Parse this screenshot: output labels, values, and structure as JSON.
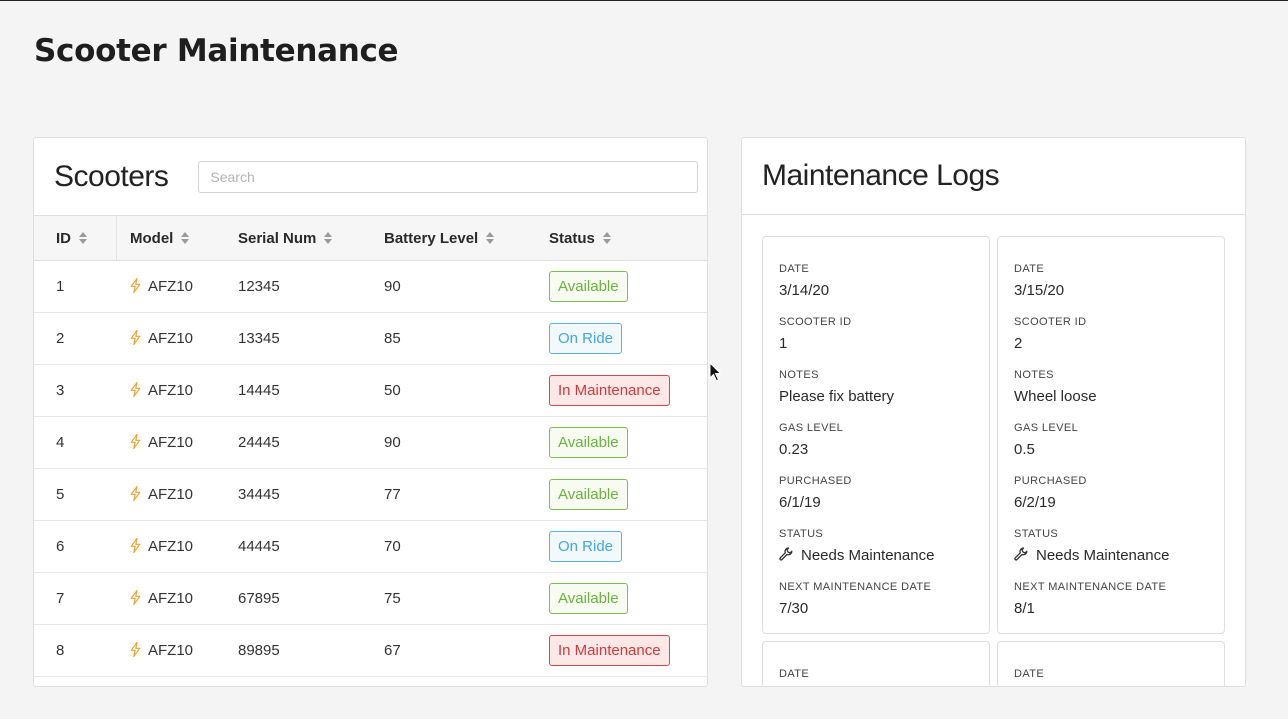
{
  "page": {
    "title": "Scooter Maintenance"
  },
  "scooters": {
    "heading": "Scooters",
    "search_placeholder": "Search",
    "columns": [
      "ID",
      "Model",
      "Serial Num",
      "Battery Level",
      "Status"
    ],
    "rows": [
      {
        "id": "1",
        "model": "AFZ10",
        "serial": "12345",
        "battery": "90",
        "status": "Available",
        "status_type": "available"
      },
      {
        "id": "2",
        "model": "AFZ10",
        "serial": "13345",
        "battery": "85",
        "status": "On Ride",
        "status_type": "onride"
      },
      {
        "id": "3",
        "model": "AFZ10",
        "serial": "14445",
        "battery": "50",
        "status": "In Maintenance",
        "status_type": "maintenance"
      },
      {
        "id": "4",
        "model": "AFZ10",
        "serial": "24445",
        "battery": "90",
        "status": "Available",
        "status_type": "available"
      },
      {
        "id": "5",
        "model": "AFZ10",
        "serial": "34445",
        "battery": "77",
        "status": "Available",
        "status_type": "available"
      },
      {
        "id": "6",
        "model": "AFZ10",
        "serial": "44445",
        "battery": "70",
        "status": "On Ride",
        "status_type": "onride"
      },
      {
        "id": "7",
        "model": "AFZ10",
        "serial": "67895",
        "battery": "75",
        "status": "Available",
        "status_type": "available"
      },
      {
        "id": "8",
        "model": "AFZ10",
        "serial": "89895",
        "battery": "67",
        "status": "In Maintenance",
        "status_type": "maintenance"
      }
    ]
  },
  "logs": {
    "heading": "Maintenance Logs",
    "labels": {
      "date": "DATE",
      "scooter_id": "SCOOTER ID",
      "notes": "NOTES",
      "gas_level": "GAS LEVEL",
      "purchased": "PURCHASED",
      "status": "STATUS",
      "next_date": "NEXT MAINTENANCE DATE"
    },
    "entries": [
      {
        "date": "3/14/20",
        "scooter_id": "1",
        "notes": "Please fix battery",
        "gas_level": "0.23",
        "purchased": "6/1/19",
        "status": "Needs Maintenance",
        "next_date": "7/30"
      },
      {
        "date": "3/15/20",
        "scooter_id": "2",
        "notes": "Wheel loose",
        "gas_level": "0.5",
        "purchased": "6/2/19",
        "status": "Needs Maintenance",
        "next_date": "8/1"
      }
    ]
  },
  "colors": {
    "available": "#6bb33d",
    "on_ride": "#3fa8de",
    "in_maintenance": "#cf3a3a",
    "bolt": "#f0a531"
  },
  "icons": {
    "model": "bolt-icon",
    "status": "wrench-icon",
    "sort": "sort-icon",
    "cursor": "cursor-icon"
  }
}
